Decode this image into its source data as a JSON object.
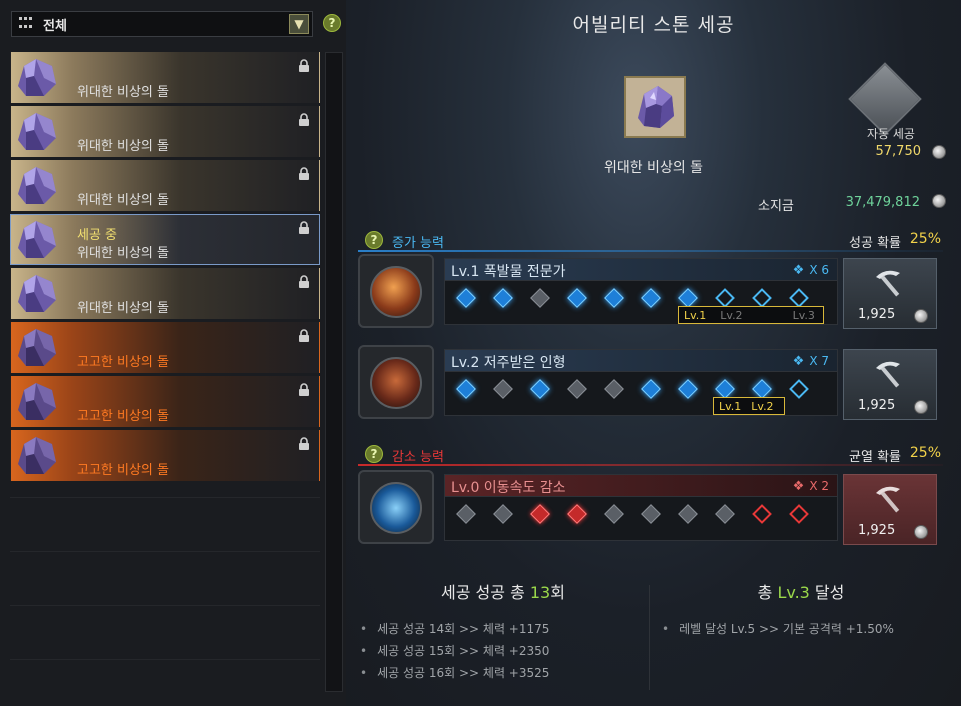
{
  "filter": {
    "label": "전체",
    "dropdown_icon": "chevron-down-icon"
  },
  "stone_list": [
    {
      "name": "위대한 비상의 돌",
      "status": "",
      "grade": "great"
    },
    {
      "name": "위대한 비상의 돌",
      "status": "",
      "grade": "great"
    },
    {
      "name": "위대한 비상의 돌",
      "status": "",
      "grade": "great"
    },
    {
      "name": "위대한 비상의 돌",
      "status": "세공 중",
      "grade": "great",
      "selected": true
    },
    {
      "name": "위대한 비상의 돌",
      "status": "",
      "grade": "great"
    },
    {
      "name": "고고한 비상의 돌",
      "status": "",
      "grade": "noble"
    },
    {
      "name": "고고한 비상의 돌",
      "status": "",
      "grade": "noble"
    },
    {
      "name": "고고한 비상의 돌",
      "status": "",
      "grade": "noble"
    }
  ],
  "main": {
    "title": "어빌리티 스톤 세공",
    "stone_name": "위대한 비상의 돌",
    "auto_craft": {
      "label": "자동 세공",
      "cost": "57,750"
    },
    "gold": {
      "label": "소지금",
      "value": "37,479,812"
    }
  },
  "increase": {
    "heading": "증가 능력",
    "rate_label": "성공 확률",
    "rate_value": "25%",
    "abilities": [
      {
        "name": "Lv.1  폭발물 전문가",
        "multiplier": "X 6",
        "nodes": [
          "hit",
          "hit",
          "miss",
          "hit",
          "hit",
          "hit",
          "hit",
          "empty",
          "empty",
          "empty"
        ],
        "tags": [
          "Lv.1",
          "Lv.2",
          "Lv.3"
        ],
        "tags_active": 1,
        "cost": "1,925"
      },
      {
        "name": "Lv.2  저주받은 인형",
        "multiplier": "X 7",
        "nodes": [
          "hit",
          "miss",
          "hit",
          "miss",
          "miss",
          "hit",
          "hit",
          "hit",
          "hit",
          "empty"
        ],
        "tags": [
          "Lv.1",
          "Lv.2"
        ],
        "tags_active": 2,
        "cost": "1,925"
      }
    ]
  },
  "decrease": {
    "heading": "감소 능력",
    "rate_label": "균열 확률",
    "rate_value": "25%",
    "ability": {
      "name": "Lv.0  이동속도 감소",
      "multiplier": "X 2",
      "nodes": [
        "miss",
        "miss",
        "hit-red",
        "hit-red",
        "miss",
        "miss",
        "miss",
        "miss",
        "empty-red",
        "empty-red"
      ],
      "cost": "1,925"
    }
  },
  "summary": {
    "success_prefix": "세공 성공 총 ",
    "success_count": "13",
    "success_suffix": "회",
    "success_bullets": [
      "세공 성공 14회 >> 체력 +1175",
      "세공 성공 15회 >> 체력 +2350",
      "세공 성공 16회 >> 체력 +3525"
    ],
    "level_prefix": "총 ",
    "level_value": "Lv.3",
    "level_suffix": " 달성",
    "level_bullets": [
      "레벨 달성 Lv.5 >> 기본 공격력 +1.50%"
    ]
  },
  "colors": {
    "increase_accent": "#4ab8f2",
    "decrease_accent": "#e83838",
    "rate_highlight": "#f2d24a",
    "noble_text": "#ff7a22",
    "gold_value": "#6ed29a"
  }
}
